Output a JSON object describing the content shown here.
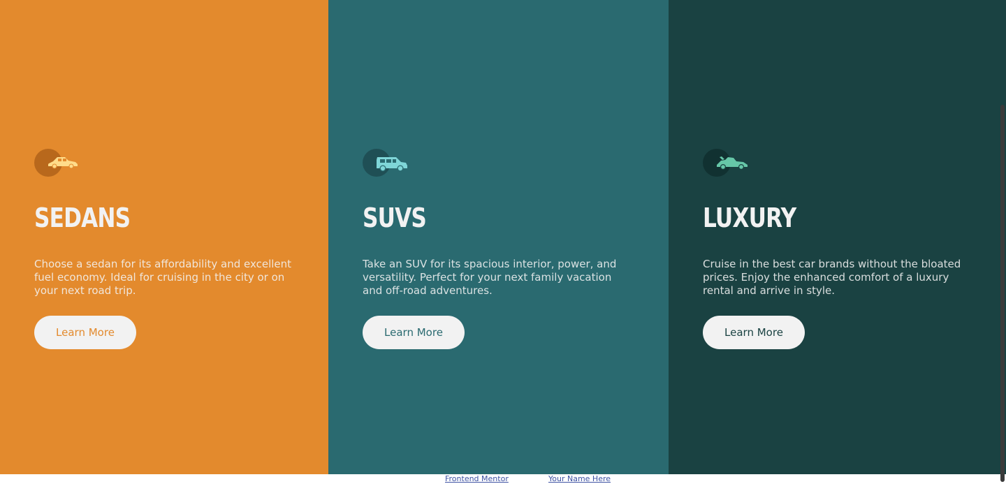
{
  "cards": [
    {
      "title": "SEDANS",
      "description": "Choose a sedan for its affordability and excellent fuel economy. Ideal for cruising in the city or on your next road trip.",
      "button_label": "Learn More",
      "icon": "sedan-car-icon",
      "color": "#e38a2d"
    },
    {
      "title": "SUVS",
      "description": "Take an SUV for its spacious interior, power, and versatility. Perfect for your next family vacation and off-road adventures.",
      "button_label": "Learn More",
      "icon": "suv-car-icon",
      "color": "#2a6a70"
    },
    {
      "title": "LUXURY",
      "description": "Cruise in the best car brands without the bloated prices. Enjoy the enhanced comfort of a luxury rental and arrive in style.",
      "button_label": "Learn More",
      "icon": "luxury-car-icon",
      "color": "#1a4242"
    }
  ],
  "attribution": {
    "link1": "Frontend Mentor",
    "link2": "Your Name Here"
  },
  "colors": {
    "sedans": "#e38a2d",
    "suvs": "#2a6a70",
    "luxury": "#1a4242",
    "text_light": "#f2f2f2",
    "link": "#3e52a3"
  }
}
